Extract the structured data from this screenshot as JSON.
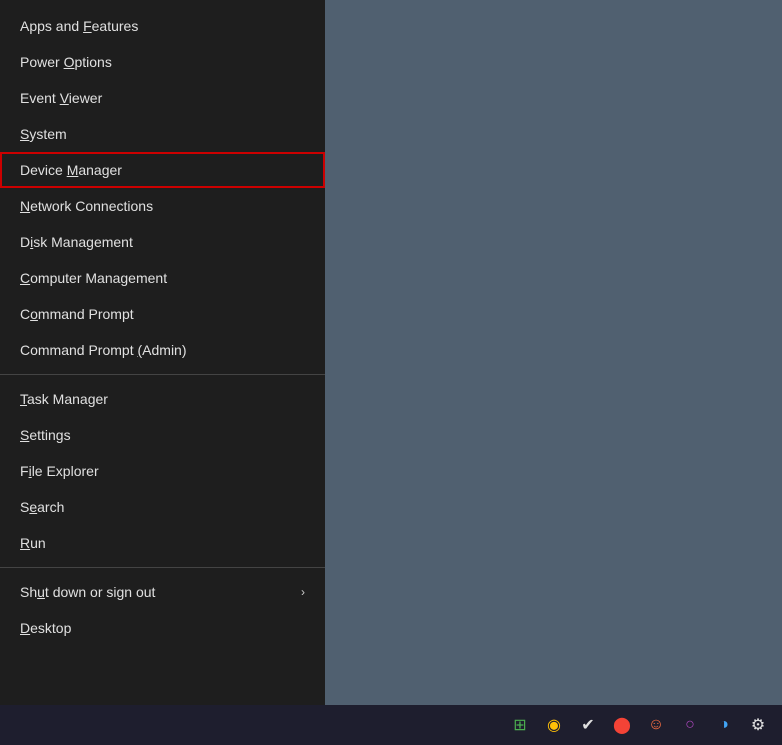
{
  "desktop": {
    "background_color": "#506070"
  },
  "context_menu": {
    "items": [
      {
        "id": "apps-features",
        "label": "Apps and Features",
        "underline_index": 9,
        "has_submenu": false,
        "separator_after": false,
        "highlighted": false
      },
      {
        "id": "power-options",
        "label": "Power Options",
        "underline_index": 6,
        "has_submenu": false,
        "separator_after": false,
        "highlighted": false
      },
      {
        "id": "event-viewer",
        "label": "Event Viewer",
        "underline_index": 6,
        "has_submenu": false,
        "separator_after": false,
        "highlighted": false
      },
      {
        "id": "system",
        "label": "System",
        "underline_index": 0,
        "has_submenu": false,
        "separator_after": false,
        "highlighted": false
      },
      {
        "id": "device-manager",
        "label": "Device Manager",
        "underline_index": 7,
        "has_submenu": false,
        "separator_after": false,
        "highlighted": true
      },
      {
        "id": "network-connections",
        "label": "Network Connections",
        "underline_index": 0,
        "has_submenu": false,
        "separator_after": false,
        "highlighted": false
      },
      {
        "id": "disk-management",
        "label": "Disk Management",
        "underline_index": 1,
        "has_submenu": false,
        "separator_after": false,
        "highlighted": false
      },
      {
        "id": "computer-management",
        "label": "Computer Management",
        "underline_index": 0,
        "has_submenu": false,
        "separator_after": false,
        "highlighted": false
      },
      {
        "id": "command-prompt",
        "label": "Command Prompt",
        "underline_index": 1,
        "has_submenu": false,
        "separator_after": false,
        "highlighted": false
      },
      {
        "id": "command-prompt-admin",
        "label": "Command Prompt (Admin)",
        "underline_index": 15,
        "has_submenu": false,
        "separator_after": true,
        "highlighted": false
      },
      {
        "id": "task-manager",
        "label": "Task Manager",
        "underline_index": 0,
        "has_submenu": false,
        "separator_after": false,
        "highlighted": false
      },
      {
        "id": "settings",
        "label": "Settings",
        "underline_index": 0,
        "has_submenu": false,
        "separator_after": false,
        "highlighted": false
      },
      {
        "id": "file-explorer",
        "label": "File Explorer",
        "underline_index": 1,
        "has_submenu": false,
        "separator_after": false,
        "highlighted": false
      },
      {
        "id": "search",
        "label": "Search",
        "underline_index": 1,
        "has_submenu": false,
        "separator_after": false,
        "highlighted": false
      },
      {
        "id": "run",
        "label": "Run",
        "underline_index": 0,
        "has_submenu": false,
        "separator_after": true,
        "highlighted": false
      },
      {
        "id": "shut-down",
        "label": "Shut down or sign out",
        "underline_index": 2,
        "has_submenu": true,
        "separator_after": false,
        "highlighted": false
      },
      {
        "id": "desktop",
        "label": "Desktop",
        "underline_index": 0,
        "has_submenu": false,
        "separator_after": false,
        "highlighted": false
      }
    ]
  },
  "taskbar": {
    "icons": [
      {
        "id": "taskbar-icon-1",
        "symbol": "⊞",
        "color": "icon-green",
        "label": "RSS/Feed icon"
      },
      {
        "id": "taskbar-icon-2",
        "symbol": "◉",
        "color": "icon-yellow",
        "label": "Yellow circle icon"
      },
      {
        "id": "taskbar-icon-3",
        "symbol": "✔",
        "color": "icon-white",
        "label": "Check icon"
      },
      {
        "id": "taskbar-icon-4",
        "symbol": "⬤",
        "color": "icon-red",
        "label": "Opera icon"
      },
      {
        "id": "taskbar-icon-5",
        "symbol": "☺",
        "color": "icon-orange",
        "label": "Emoji icon"
      },
      {
        "id": "taskbar-icon-6",
        "symbol": "○",
        "color": "icon-purple",
        "label": "Opera O icon"
      },
      {
        "id": "taskbar-icon-7",
        "symbol": "◑",
        "color": "icon-blue",
        "label": "Browser icon"
      },
      {
        "id": "taskbar-icon-8",
        "symbol": "⚙",
        "color": "icon-white",
        "label": "Settings gear icon"
      }
    ]
  }
}
